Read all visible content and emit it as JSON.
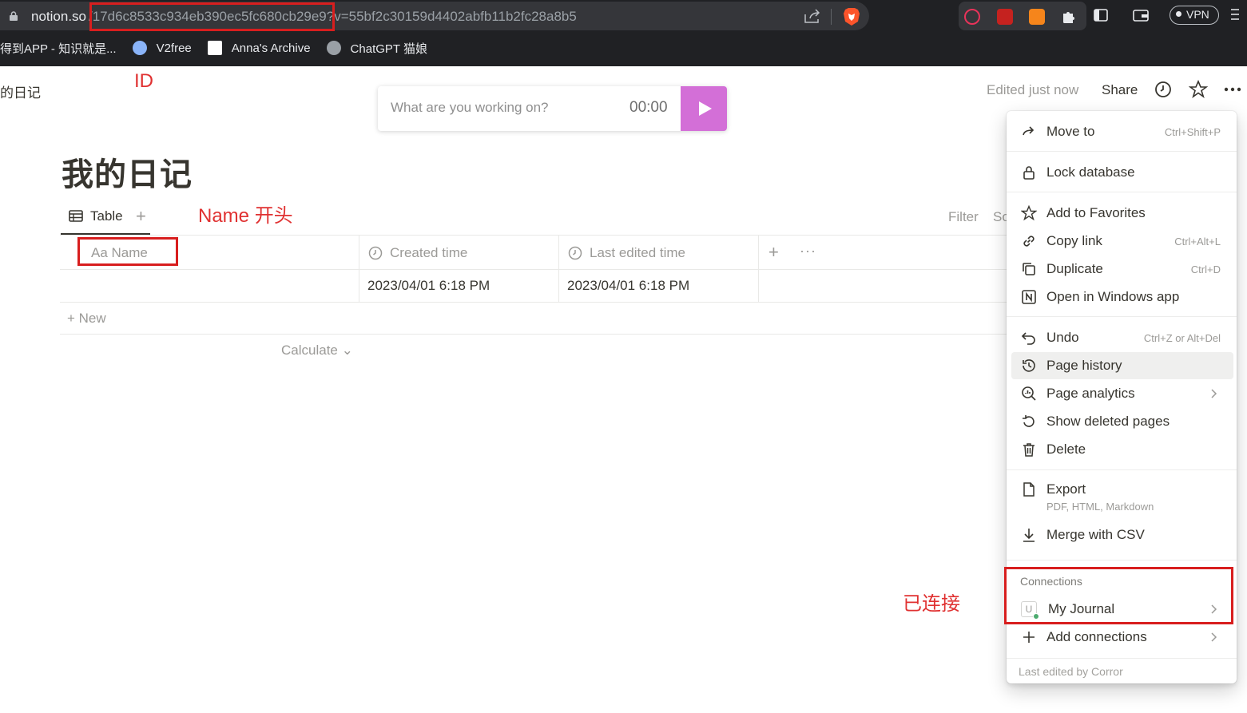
{
  "browser": {
    "url_host": "notion.so",
    "url_path": "/17d6c8533c934eb390ec5fc680cb29e9?v=55bf2c30159d4402abfb11b2fc28a8b5",
    "vpn_label": "VPN",
    "bookmarks": [
      {
        "label": "得到APP - 知识就是..."
      },
      {
        "label": "V2free"
      },
      {
        "label": "Anna's Archive"
      },
      {
        "label": "ChatGPT 猫娘"
      }
    ]
  },
  "page": {
    "breadcrumb": "的日记",
    "title": "我的日记",
    "edited_status": "Edited just now",
    "share_label": "Share"
  },
  "timer": {
    "placeholder": "What are you working on?",
    "time": "00:00"
  },
  "database": {
    "view_tab": "Table",
    "filter_label": "Filter",
    "sort_label": "So",
    "columns": [
      "Aa Name",
      "Created time",
      "Last edited time"
    ],
    "rows": [
      {
        "name": "",
        "created": "2023/04/01 6:18 PM",
        "edited": "2023/04/01 6:18 PM"
      }
    ],
    "new_label": "+ New",
    "calculate_label": "Calculate"
  },
  "annotations": {
    "id": "ID",
    "name_start": "Name 开头",
    "connected": "已连接"
  },
  "menu": {
    "items": [
      {
        "label": "Move to",
        "shortcut": "Ctrl+Shift+P",
        "icon": "arrow-right-icon"
      },
      {
        "label": "Lock database",
        "icon": "lock-icon"
      },
      {
        "label": "Add to Favorites",
        "icon": "star-icon"
      },
      {
        "label": "Copy link",
        "shortcut": "Ctrl+Alt+L",
        "icon": "link-icon"
      },
      {
        "label": "Duplicate",
        "shortcut": "Ctrl+D",
        "icon": "duplicate-icon"
      },
      {
        "label": "Open in Windows app",
        "icon": "notion-icon"
      },
      {
        "label": "Undo",
        "shortcut": "Ctrl+Z or Alt+Del",
        "icon": "undo-icon"
      },
      {
        "label": "Page history",
        "icon": "history-icon"
      },
      {
        "label": "Page analytics",
        "icon": "analytics-icon"
      },
      {
        "label": "Show deleted pages",
        "icon": "restore-icon"
      },
      {
        "label": "Delete",
        "icon": "trash-icon"
      },
      {
        "label": "Export",
        "sub": "PDF, HTML, Markdown",
        "icon": "export-icon"
      },
      {
        "label": "Merge with CSV",
        "icon": "download-icon"
      }
    ],
    "connections_heading": "Connections",
    "connection_name": "My Journal",
    "add_connections": "Add connections",
    "footer": "Last edited by Corror"
  }
}
